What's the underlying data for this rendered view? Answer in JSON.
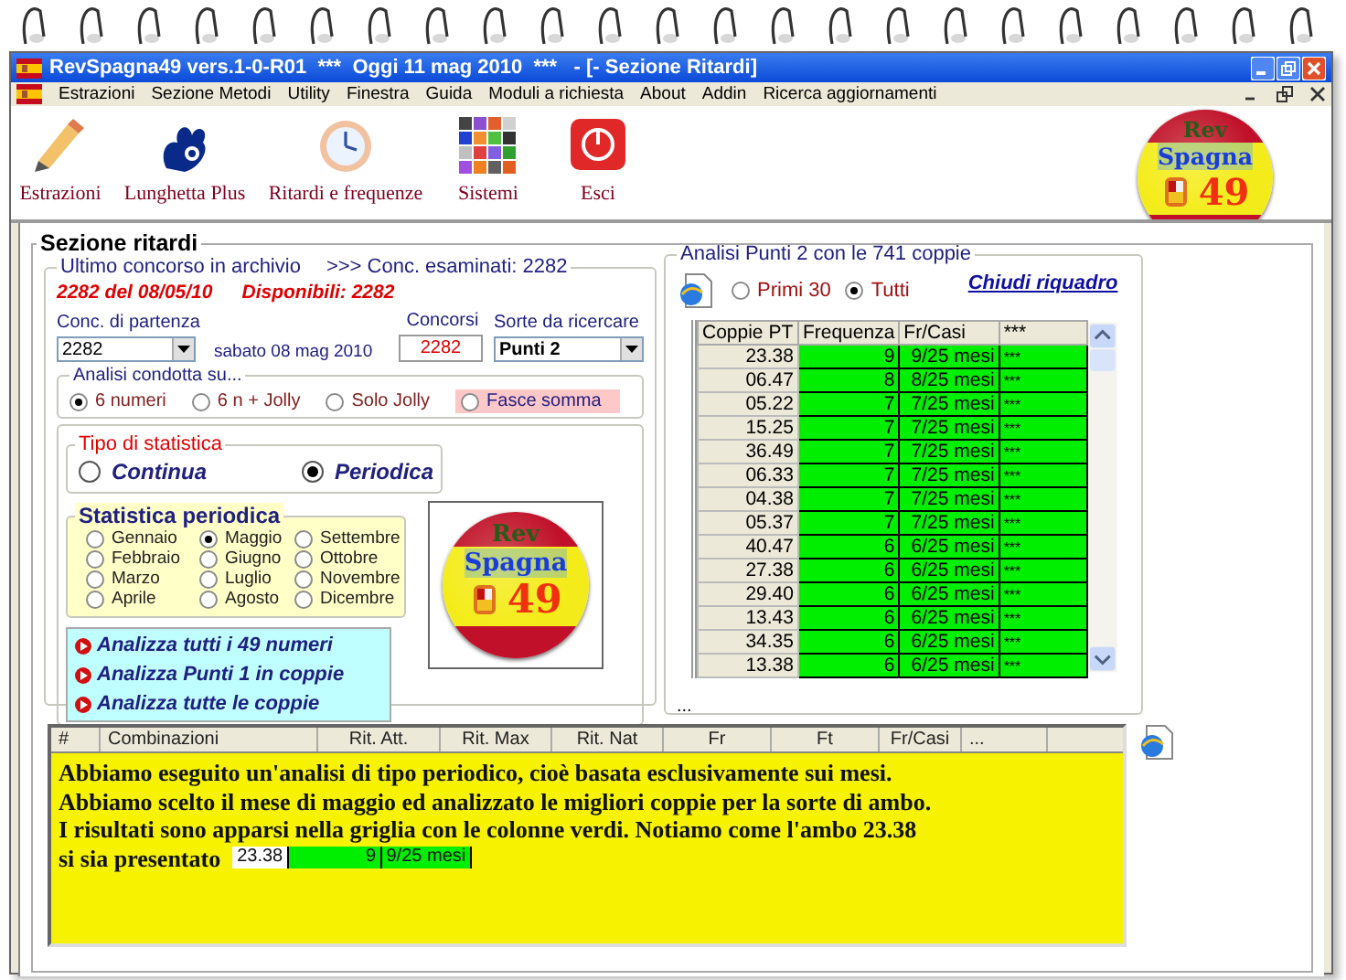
{
  "window": {
    "title": "RevSpagna49 vers.1-0-R01  ***  Oggi 11 mag 2010  ***   - [- Sezione Ritardi]"
  },
  "menu": [
    "Estrazioni",
    "Sezione Metodi",
    "Utility",
    "Finestra",
    "Guida",
    "Moduli a richiesta",
    "About",
    "Addin",
    "Ricerca aggiornamenti"
  ],
  "toolbar": [
    {
      "label": "Estrazioni",
      "kind": "pencil"
    },
    {
      "label": "Lunghetta Plus",
      "kind": "hand"
    },
    {
      "label": "Ritardi e frequenze",
      "kind": "clock"
    },
    {
      "label": "Sistemi",
      "kind": "grid"
    },
    {
      "label": "Esci",
      "kind": "power"
    }
  ],
  "logos": [
    {
      "top": "Rev",
      "middle": "Spagna",
      "number": "49"
    },
    {
      "top": "Rev",
      "middle": "Spagna",
      "number": "49"
    }
  ],
  "section_title": "Sezione ritardi",
  "archive": {
    "legend": "Ultimo concorso in archivio",
    "examined": ">>> Conc. esaminati: 2282",
    "last": "2282 del 08/05/10",
    "available": "Disponibili: 2282",
    "start_label": "Conc. di partenza",
    "start_value": "2282",
    "date": "sabato 08 mag 2010",
    "draws_label": "Concorsi",
    "draws_value": "2282",
    "sort_label": "Sorte da ricercare",
    "sort_value": "Punti 2"
  },
  "analysis": {
    "legend": "Analisi condotta su...",
    "options": [
      {
        "label": "6 numeri",
        "selected": true,
        "highlighted": false
      },
      {
        "label": "6 n + Jolly",
        "selected": false,
        "highlighted": false
      },
      {
        "label": "Solo Jolly",
        "selected": false,
        "highlighted": false
      },
      {
        "label": "Fasce somma",
        "selected": false,
        "highlighted": true
      }
    ]
  },
  "stat_type": {
    "legend": "Tipo di statistica",
    "options": [
      {
        "label": "Continua",
        "selected": false
      },
      {
        "label": "Periodica",
        "selected": true
      }
    ]
  },
  "periodic": {
    "legend": "Statistica periodica",
    "months": [
      {
        "label": "Gennaio",
        "selected": false
      },
      {
        "label": "Febbraio",
        "selected": false
      },
      {
        "label": "Marzo",
        "selected": false
      },
      {
        "label": "Aprile",
        "selected": false
      },
      {
        "label": "Maggio",
        "selected": true
      },
      {
        "label": "Giugno",
        "selected": false
      },
      {
        "label": "Luglio",
        "selected": false
      },
      {
        "label": "Agosto",
        "selected": false
      },
      {
        "label": "Settembre",
        "selected": false
      },
      {
        "label": "Ottobre",
        "selected": false
      },
      {
        "label": "Novembre",
        "selected": false
      },
      {
        "label": "Dicembre",
        "selected": false
      }
    ]
  },
  "actions": [
    "Analizza tutti i 49 numeri",
    "Analizza Punti 1 in coppie",
    "Analizza tutte le coppie"
  ],
  "pairs": {
    "legend": "Analisi Punti 2 con le 741 coppie",
    "options": [
      {
        "label": "Primi 30",
        "selected": false
      },
      {
        "label": "Tutti",
        "selected": true
      }
    ],
    "close_link": "Chiudi riquadro",
    "columns": [
      "Coppie PT",
      "Frequenza",
      "Fr/Casi",
      "***"
    ],
    "rows": [
      {
        "pair": "23.38",
        "freq": "9",
        "ratio": "9/25 mesi",
        "note": "***"
      },
      {
        "pair": "06.47",
        "freq": "8",
        "ratio": "8/25 mesi",
        "note": "***"
      },
      {
        "pair": "05.22",
        "freq": "7",
        "ratio": "7/25 mesi",
        "note": "***"
      },
      {
        "pair": "15.25",
        "freq": "7",
        "ratio": "7/25 mesi",
        "note": "***"
      },
      {
        "pair": "36.49",
        "freq": "7",
        "ratio": "7/25 mesi",
        "note": "***"
      },
      {
        "pair": "06.33",
        "freq": "7",
        "ratio": "7/25 mesi",
        "note": "***"
      },
      {
        "pair": "04.38",
        "freq": "7",
        "ratio": "7/25 mesi",
        "note": "***"
      },
      {
        "pair": "05.37",
        "freq": "7",
        "ratio": "7/25 mesi",
        "note": "***"
      },
      {
        "pair": "40.47",
        "freq": "6",
        "ratio": "6/25 mesi",
        "note": "***"
      },
      {
        "pair": "27.38",
        "freq": "6",
        "ratio": "6/25 mesi",
        "note": "***"
      },
      {
        "pair": "29.40",
        "freq": "6",
        "ratio": "6/25 mesi",
        "note": "***"
      },
      {
        "pair": "13.43",
        "freq": "6",
        "ratio": "6/25 mesi",
        "note": "***"
      },
      {
        "pair": "34.35",
        "freq": "6",
        "ratio": "6/25 mesi",
        "note": "***"
      },
      {
        "pair": "13.38",
        "freq": "6",
        "ratio": "6/25 mesi",
        "note": "***"
      }
    ],
    "footer": "..."
  },
  "results": {
    "columns": [
      "#",
      "Combinazioni",
      "Rit. Att.",
      "Rit. Max",
      "Rit. Nat",
      "Fr",
      "Ft",
      "Fr/Casi",
      "..."
    ],
    "note": [
      "Abbiamo eseguito un'analisi di tipo periodico, cioè basata esclusivamente sui mesi.",
      "Abbiamo scelto il mese di maggio ed analizzato le migliori coppie per la sorte di ambo.",
      "I risultati sono apparsi nella griglia con le colonne verdi. Notiamo come l'ambo 23.38",
      "si sia presentato"
    ],
    "overlay_row": {
      "pair": "23.38",
      "freq": "9",
      "ratio": "9/25 mesi"
    }
  }
}
